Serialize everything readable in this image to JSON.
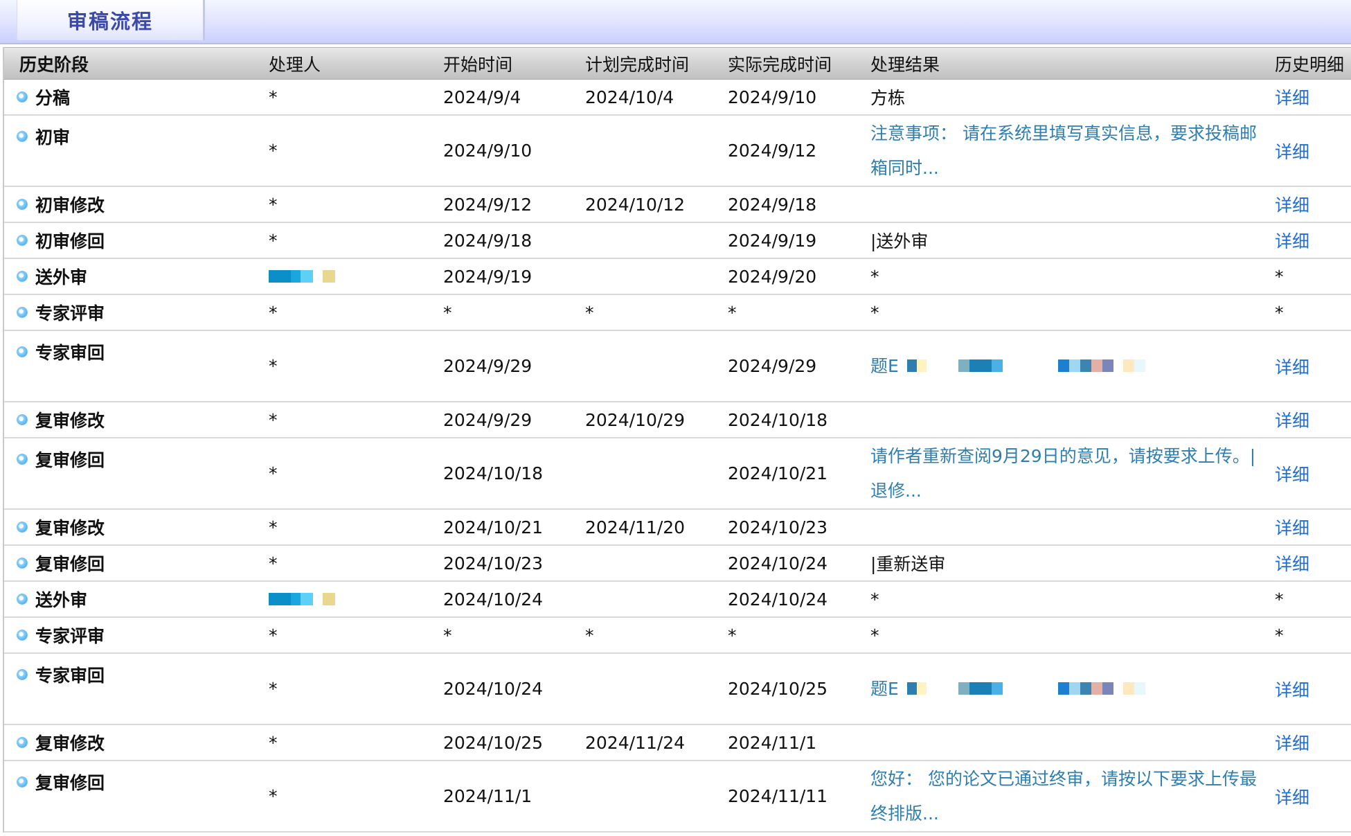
{
  "tab": {
    "title": "审稿流程"
  },
  "columns": [
    "历史阶段",
    "处理人",
    "开始时间",
    "计划完成时间",
    "实际完成时间",
    "处理结果",
    "历史明细"
  ],
  "rows": [
    {
      "stage": "分稿",
      "handler": "*",
      "start": "2024/9/4",
      "plan": "2024/10/4",
      "actual": "2024/9/10",
      "result": "方栋",
      "result_is_link": false,
      "detail": "详细",
      "detail_is_link": true,
      "tall": false
    },
    {
      "stage": "初审",
      "handler": "*",
      "start": "2024/9/10",
      "plan": "",
      "actual": "2024/9/12",
      "result": "注意事项： 请在系统里填写真实信息，要求投稿邮箱同时...",
      "result_is_link": true,
      "detail": "详细",
      "detail_is_link": true,
      "tall": true
    },
    {
      "stage": "初审修改",
      "handler": "*",
      "start": "2024/9/12",
      "plan": "2024/10/12",
      "actual": "2024/9/18",
      "result": "",
      "result_is_link": false,
      "detail": "详细",
      "detail_is_link": true,
      "tall": false
    },
    {
      "stage": "初审修回",
      "handler": "*",
      "start": "2024/9/18",
      "plan": "",
      "actual": "2024/9/19",
      "result": "|送外审",
      "result_is_link": false,
      "detail": "详细",
      "detail_is_link": true,
      "tall": false
    },
    {
      "stage": "送外审",
      "handler": "",
      "start": "2024/9/19",
      "plan": "",
      "actual": "2024/9/20",
      "result": "*",
      "result_is_link": false,
      "detail": "*",
      "detail_is_link": false,
      "tall": false,
      "handler_redacted": true
    },
    {
      "stage": "专家评审",
      "handler": "*",
      "start": "*",
      "plan": "*",
      "actual": "*",
      "result": "*",
      "result_is_link": false,
      "detail": "*",
      "detail_is_link": false,
      "tall": false
    },
    {
      "stage": "专家审回",
      "handler": "*",
      "start": "2024/9/29",
      "plan": "",
      "actual": "2024/9/29",
      "result": "题E",
      "result_is_link": true,
      "detail": "详细",
      "detail_is_link": true,
      "tall": true,
      "result_redacted": true
    },
    {
      "stage": "复审修改",
      "handler": "*",
      "start": "2024/9/29",
      "plan": "2024/10/29",
      "actual": "2024/10/18",
      "result": "",
      "result_is_link": false,
      "detail": "详细",
      "detail_is_link": true,
      "tall": false
    },
    {
      "stage": "复审修回",
      "handler": "*",
      "start": "2024/10/18",
      "plan": "",
      "actual": "2024/10/21",
      "result": "请作者重新查阅9月29日的意见，请按要求上传。|退修...",
      "result_is_link": true,
      "detail": "详细",
      "detail_is_link": true,
      "tall": true
    },
    {
      "stage": "复审修改",
      "handler": "*",
      "start": "2024/10/21",
      "plan": "2024/11/20",
      "actual": "2024/10/23",
      "result": "",
      "result_is_link": false,
      "detail": "详细",
      "detail_is_link": true,
      "tall": false
    },
    {
      "stage": "复审修回",
      "handler": "*",
      "start": "2024/10/23",
      "plan": "",
      "actual": "2024/10/24",
      "result": "|重新送审",
      "result_is_link": false,
      "detail": "详细",
      "detail_is_link": true,
      "tall": false
    },
    {
      "stage": "送外审",
      "handler": "",
      "start": "2024/10/24",
      "plan": "",
      "actual": "2024/10/24",
      "result": "*",
      "result_is_link": false,
      "detail": "*",
      "detail_is_link": false,
      "tall": false,
      "handler_redacted": true
    },
    {
      "stage": "专家评审",
      "handler": "*",
      "start": "*",
      "plan": "*",
      "actual": "*",
      "result": "*",
      "result_is_link": false,
      "detail": "*",
      "detail_is_link": false,
      "tall": false
    },
    {
      "stage": "专家审回",
      "handler": "*",
      "start": "2024/10/24",
      "plan": "",
      "actual": "2024/10/25",
      "result": "题E",
      "result_is_link": true,
      "detail": "详细",
      "detail_is_link": true,
      "tall": true,
      "result_redacted": true
    },
    {
      "stage": "复审修改",
      "handler": "*",
      "start": "2024/10/25",
      "plan": "2024/11/24",
      "actual": "2024/11/1",
      "result": "",
      "result_is_link": false,
      "detail": "详细",
      "detail_is_link": true,
      "tall": false
    },
    {
      "stage": "复审修回",
      "handler": "*",
      "start": "2024/11/1",
      "plan": "",
      "actual": "2024/11/11",
      "result": "您好： 您的论文已通过终审，请按以下要求上传最终排版...",
      "result_is_link": true,
      "detail": "详细",
      "detail_is_link": true,
      "tall": true
    }
  ],
  "colors": {
    "link": "#1f6fd6",
    "result_link": "#2f7eb0",
    "header_bg": "#cfcfcf",
    "tab_text": "#3b4aa8"
  }
}
